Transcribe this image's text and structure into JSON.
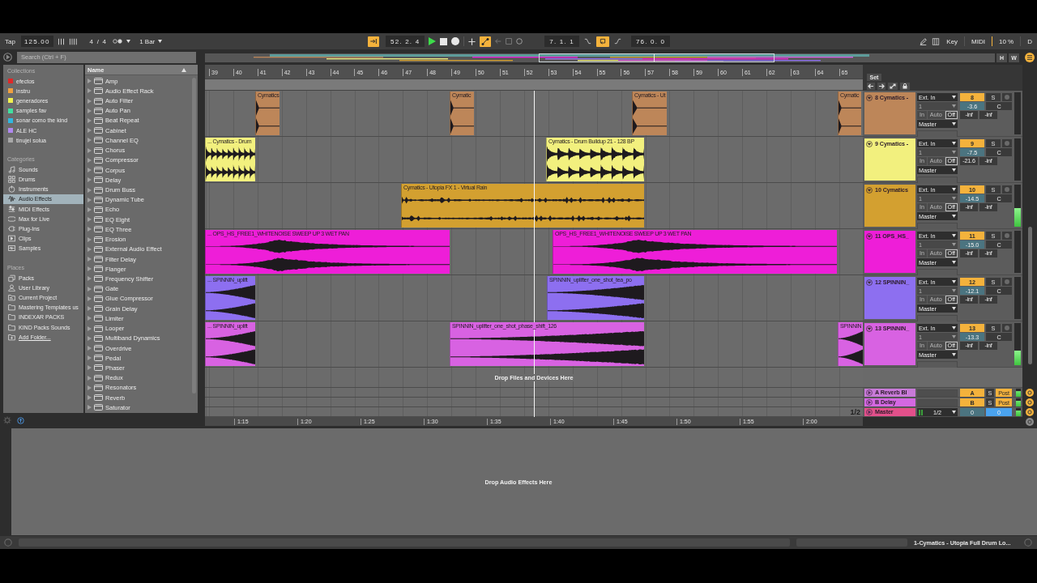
{
  "control_bar": {
    "tap": "Tap",
    "tempo": "125.00",
    "time_signature": "4 / 4",
    "quantization": "1 Bar",
    "follow": true,
    "position": "52. 2. 4",
    "playing": true,
    "automation_arm": true,
    "loop_start": "7. 1. 1",
    "loop": true,
    "loop_length": "76. 0. 0",
    "key": "Key",
    "midi": "MIDI",
    "cpu": "10 %",
    "disk": "D"
  },
  "browser": {
    "search_placeholder": "Search (Ctrl + F)",
    "collections_title": "Collections",
    "collections": [
      {
        "label": "efectos",
        "color": "#e02828"
      },
      {
        "label": "instru",
        "color": "#f0a040"
      },
      {
        "label": "generadores",
        "color": "#f0f050"
      },
      {
        "label": "samples fav",
        "color": "#40e0a0"
      },
      {
        "label": "sonar como the kind",
        "color": "#30b8e0"
      },
      {
        "label": "ALE HC",
        "color": "#b088f0"
      },
      {
        "label": "tinujei solua",
        "color": "#a8a8a8"
      }
    ],
    "categories_title": "Categories",
    "categories": [
      {
        "label": "Sounds",
        "selected": false
      },
      {
        "label": "Drums",
        "selected": false
      },
      {
        "label": "Instruments",
        "selected": false
      },
      {
        "label": "Audio Effects",
        "selected": true
      },
      {
        "label": "MIDI Effects",
        "selected": false
      },
      {
        "label": "Max for Live",
        "selected": false
      },
      {
        "label": "Plug-Ins",
        "selected": false
      },
      {
        "label": "Clips",
        "selected": false
      },
      {
        "label": "Samples",
        "selected": false
      }
    ],
    "places_title": "Places",
    "places": [
      "Packs",
      "User Library",
      "Current Project",
      "Mastering Templates us",
      "INDEXAR PACKS",
      "KIND Packs Sounds"
    ],
    "add_folder": "Add Folder...",
    "column_title": "Name",
    "items": [
      "Amp",
      "Audio Effect Rack",
      "Auto Filter",
      "Auto Pan",
      "Beat Repeat",
      "Cabinet",
      "Channel EQ",
      "Chorus",
      "Compressor",
      "Corpus",
      "Delay",
      "Drum Buss",
      "Dynamic Tube",
      "Echo",
      "EQ Eight",
      "EQ Three",
      "Erosion",
      "External Audio Effect",
      "Filter Delay",
      "Flanger",
      "Frequency Shifter",
      "Gate",
      "Glue Compressor",
      "Grain Delay",
      "Limiter",
      "Looper",
      "Multiband Dynamics",
      "Overdrive",
      "Pedal",
      "Phaser",
      "Redux",
      "Resonators",
      "Reverb",
      "Saturator"
    ]
  },
  "arrangement": {
    "overview_buttons": [
      "H",
      "W"
    ],
    "bar_numbers": [
      "39",
      "40",
      "41",
      "42",
      "43",
      "44",
      "45",
      "46",
      "47",
      "48",
      "49",
      "50",
      "51",
      "52",
      "53",
      "54",
      "55",
      "56",
      "57",
      "58",
      "59",
      "60",
      "61",
      "62",
      "63",
      "64",
      "65"
    ],
    "set_label": "Set",
    "tracks": [
      {
        "name": "8 Cymatics -",
        "color": "#bd8659",
        "number": "8",
        "active": true,
        "soloed": false,
        "armed": false,
        "input": "Ext. In",
        "channel": {
          "value": "1",
          "disabled": true
        },
        "monitor": [
          {
            "label": "In",
            "selected": false
          },
          {
            "label": "Auto",
            "selected": false
          },
          {
            "label": "Off",
            "selected": true
          }
        ],
        "output": "Master",
        "solo": "S",
        "volume": "-3.6",
        "pan": "C",
        "peaks": [
          "-inf",
          "-inf"
        ],
        "level": 0,
        "clips": [
          {
            "name": "Cymatics",
            "kind": "hit"
          },
          {
            "name": "Cymatic",
            "kind": "hit"
          },
          {
            "name": "Cymatics - Ut",
            "kind": "hit"
          },
          {
            "name": "Cymatic",
            "kind": "hit"
          }
        ]
      },
      {
        "name": "9 Cymatics -",
        "color": "#f2f07e",
        "number": "9",
        "active": true,
        "soloed": false,
        "armed": false,
        "input": "Ext. In",
        "channel": {
          "value": "1",
          "disabled": true
        },
        "monitor": [
          {
            "label": "In",
            "selected": false
          },
          {
            "label": "Auto",
            "selected": false
          },
          {
            "label": "Off",
            "selected": true
          }
        ],
        "output": "Master",
        "solo": "S",
        "volume": "-7.5",
        "pan": "C",
        "peaks": [
          "-21.6",
          "-inf"
        ],
        "level": 0,
        "clips": [
          {
            "name": "... Cymatics - Drum",
            "kind": "drums"
          },
          {
            "name": "Cymatics - Drum Buildup 21 - 128 BP",
            "kind": "drums"
          }
        ]
      },
      {
        "name": "10 Cymatics",
        "color": "#d3a030",
        "number": "10",
        "active": true,
        "soloed": false,
        "armed": false,
        "input": "Ext. In",
        "channel": {
          "value": "1",
          "disabled": true
        },
        "monitor": [
          {
            "label": "In",
            "selected": false
          },
          {
            "label": "Auto",
            "selected": false
          },
          {
            "label": "Off",
            "selected": true
          }
        ],
        "output": "Master",
        "solo": "S",
        "volume": "-14.5",
        "pan": "C",
        "peaks": [
          "-inf",
          "-inf"
        ],
        "level": 0.45,
        "clips": [
          {
            "name": "Cymatics - Utopia FX 1 - Virtual Rain",
            "kind": "noise"
          }
        ]
      },
      {
        "name": "11 OPS_HS_",
        "color": "#ee1ed8",
        "number": "11",
        "active": true,
        "soloed": false,
        "armed": false,
        "input": "Ext. In",
        "channel": {
          "value": "1",
          "disabled": true
        },
        "monitor": [
          {
            "label": "In",
            "selected": false
          },
          {
            "label": "Auto",
            "selected": false
          },
          {
            "label": "Off",
            "selected": true
          }
        ],
        "output": "Master",
        "solo": "S",
        "volume": "-15.0",
        "pan": "C",
        "peaks": [
          "-inf",
          "-inf"
        ],
        "level": 0,
        "clips": [
          {
            "name": "... OPS_HS_FREE1_WHITENOISE SWEEP UP 3 WET PAN",
            "kind": "swell"
          },
          {
            "name": "OPS_HS_FREE1_WHITENOISE SWEEP UP 3 WET PAN",
            "kind": "swell"
          }
        ]
      },
      {
        "name": "12 SPINNIN_",
        "color": "#8d6ff0",
        "number": "12",
        "active": true,
        "soloed": false,
        "armed": false,
        "input": "Ext. In",
        "channel": {
          "value": "1",
          "disabled": true
        },
        "monitor": [
          {
            "label": "In",
            "selected": false
          },
          {
            "label": "Auto",
            "selected": false
          },
          {
            "label": "Off",
            "selected": true
          }
        ],
        "output": "Master",
        "solo": "S",
        "volume": "-12.1",
        "pan": "C",
        "peaks": [
          "-inf",
          "-inf"
        ],
        "level": 0,
        "clips": [
          {
            "name": "... SPINNIN_uplift",
            "kind": "riser"
          },
          {
            "name": "SPINNIN_uplifter_one_shot_tea_po",
            "kind": "riser"
          }
        ]
      },
      {
        "name": "13 SPINNIN_",
        "color": "#d862e2",
        "number": "13",
        "active": true,
        "soloed": false,
        "armed": false,
        "input": "Ext. In",
        "channel": {
          "value": "1",
          "disabled": true
        },
        "monitor": [
          {
            "label": "In",
            "selected": false
          },
          {
            "label": "Auto",
            "selected": false
          },
          {
            "label": "Off",
            "selected": true
          }
        ],
        "output": "Master",
        "solo": "S",
        "volume": "-13.3",
        "pan": "C",
        "peaks": [
          "-inf",
          "-inf"
        ],
        "level": 0.35,
        "clips": [
          {
            "name": "... SPINNIN_uplift",
            "kind": "riser"
          },
          {
            "name": "SPINNIN_uplifter_one_shot_phase_shift_126",
            "kind": "riser"
          },
          {
            "name": "SPINNIN",
            "kind": "riser"
          }
        ]
      }
    ],
    "drop_hint": "Drop Files and Devices Here",
    "returns": [
      {
        "name": "A Reverb Bl",
        "color": "#c87ad8",
        "letter": "A",
        "solo": "S",
        "mode": "Post",
        "signal": true
      },
      {
        "name": "B Delay",
        "color": "#d468e2",
        "letter": "B",
        "solo": "S",
        "mode": "Post",
        "signal": true
      }
    ],
    "master": {
      "name": "Master",
      "color": "#e2508a",
      "output": "1/2",
      "volume": "0",
      "pan": "0",
      "signal": true
    },
    "zoom_label": "1/2",
    "time_ruler": [
      "1:15",
      "1:20",
      "1:25",
      "1:30",
      "1:35",
      "1:40",
      "1:45",
      "1:50",
      "1:55",
      "2:00"
    ]
  },
  "detail": {
    "drop_hint": "Drop Audio Effects Here"
  },
  "status_bar": {
    "clip_name": "1-Cymatics - Utopia Full Drum Lo..."
  }
}
